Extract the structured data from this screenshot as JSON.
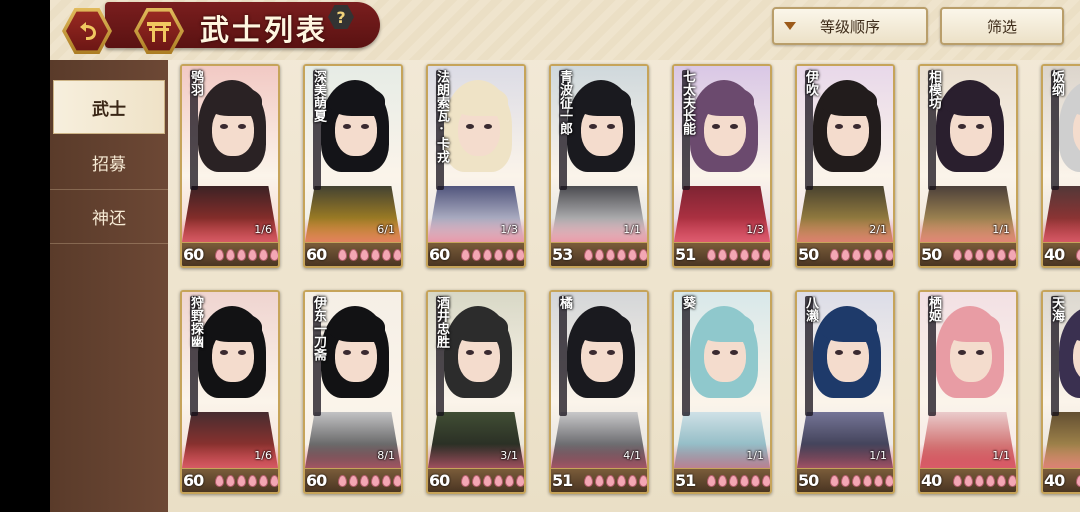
{
  "header": {
    "title": "武士列表",
    "back_icon": "back-arrow-icon",
    "home_icon": "shrine-home-icon",
    "help_label": "?",
    "sort_label": "等级顺序",
    "filter_label": "筛选"
  },
  "sidebar": {
    "items": [
      {
        "label": "武士",
        "active": true
      },
      {
        "label": "招募",
        "active": false
      },
      {
        "label": "神还",
        "active": false
      }
    ]
  },
  "cards": [
    {
      "name": "鸮羽",
      "level": "60",
      "ratio": "1/6",
      "bg": "#f2c9c4",
      "hair": "#2a2224",
      "cloth": "#1d1d22",
      "accent": "#b8352e"
    },
    {
      "name": "深美萌夏",
      "level": "60",
      "ratio": "6/1",
      "bg": "#e6ece6",
      "hair": "#141418",
      "cloth": "#1e2a38",
      "accent": "#d9a31a"
    },
    {
      "name": "法朗索瓦·卡戎",
      "level": "60",
      "ratio": "1/3",
      "bg": "#dcdce6",
      "hair": "#efe3c6",
      "cloth": "#2b3060",
      "accent": "#e9e9f0"
    },
    {
      "name": "青波征一郎",
      "level": "53",
      "ratio": "1/1",
      "bg": "#cfd8dc",
      "hair": "#1a1a1f",
      "cloth": "#222228",
      "accent": "#f0f0f0"
    },
    {
      "name": "七太夫长能",
      "level": "51",
      "ratio": "1/3",
      "bg": "#d9c7e6",
      "hair": "#6b4a6e",
      "cloth": "#6a1e2c",
      "accent": "#cc3a4c"
    },
    {
      "name": "伊吹",
      "level": "50",
      "ratio": "2/1",
      "bg": "#e8d8ea",
      "hair": "#221c1c",
      "cloth": "#2a2a28",
      "accent": "#c5a24a"
    },
    {
      "name": "相模坊",
      "level": "50",
      "ratio": "1/1",
      "bg": "#eadfd0",
      "hair": "#2a1f2e",
      "cloth": "#2a2430",
      "accent": "#d4b060"
    },
    {
      "name": "饭纲",
      "level": "40",
      "ratio": "",
      "bg": "#dcd5cc",
      "hair": "#cfcfcf",
      "cloth": "#3a3a3a",
      "accent": "#b43030"
    },
    {
      "name": "狩野探幽",
      "level": "60",
      "ratio": "1/6",
      "bg": "#efd4d0",
      "hair": "#121214",
      "cloth": "#2a2a30",
      "accent": "#b8352e"
    },
    {
      "name": "伊东一刀斋",
      "level": "60",
      "ratio": "8/1",
      "bg": "#f5efe6",
      "hair": "#121214",
      "cloth": "#e8e8ea",
      "accent": "#2a2a2a"
    },
    {
      "name": "酒井忠胜",
      "level": "60",
      "ratio": "3/1",
      "bg": "#d8d8c6",
      "hair": "#2c2c2c",
      "cloth": "#4a5a3a",
      "accent": "#1b1b1b"
    },
    {
      "name": "橘",
      "level": "51",
      "ratio": "4/1",
      "bg": "#d4d6d8",
      "hair": "#1a1a1f",
      "cloth": "#f0f0f0",
      "accent": "#2a2a30"
    },
    {
      "name": "葵",
      "level": "51",
      "ratio": "1/1",
      "bg": "#d8e8ea",
      "hair": "#8fc8cc",
      "cloth": "#e8f0f4",
      "accent": "#6ba4b0"
    },
    {
      "name": "八濑",
      "level": "50",
      "ratio": "1/1",
      "bg": "#dcdde8",
      "hair": "#1e3a6a",
      "cloth": "#8a8ab0",
      "accent": "#202030"
    },
    {
      "name": "栖姬",
      "level": "40",
      "ratio": "1/1",
      "bg": "#f2e0e4",
      "hair": "#e89ca4",
      "cloth": "#f4f0f0",
      "accent": "#c23a3a"
    },
    {
      "name": "天海",
      "level": "40",
      "ratio": "",
      "bg": "#dcd8d0",
      "hair": "#3a3050",
      "cloth": "#4a3a28",
      "accent": "#c6a45a"
    }
  ],
  "petal_count": 7
}
